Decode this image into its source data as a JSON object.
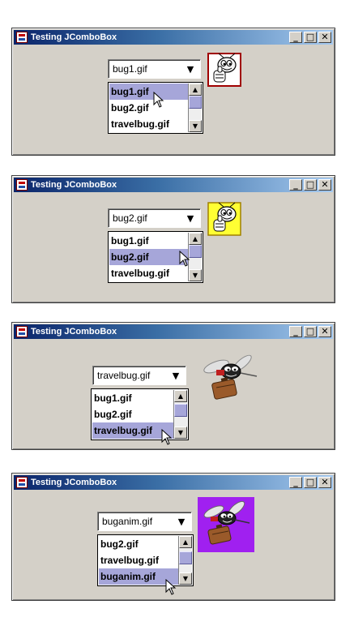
{
  "windows": [
    {
      "title": "Testing JComboBox",
      "combo_value": "bug1.gif",
      "items": [
        "bug1.gif",
        "bug2.gif",
        "travelbug.gif"
      ],
      "selected_index": 0,
      "image": "bug1-icon",
      "buttons": {
        "minimize": "_",
        "maximize": "□",
        "close": "✕"
      }
    },
    {
      "title": "Testing JComboBox",
      "combo_value": "bug2.gif",
      "items": [
        "bug1.gif",
        "bug2.gif",
        "travelbug.gif"
      ],
      "selected_index": 1,
      "image": "bug2-icon",
      "buttons": {
        "minimize": "_",
        "maximize": "□",
        "close": "✕"
      }
    },
    {
      "title": "Testing JComboBox",
      "combo_value": "travelbug.gif",
      "items": [
        "bug1.gif",
        "bug2.gif",
        "travelbug.gif"
      ],
      "selected_index": 2,
      "image": "travelbug-icon",
      "buttons": {
        "minimize": "_",
        "maximize": "□",
        "close": "✕"
      }
    },
    {
      "title": "Testing JComboBox",
      "combo_value": "buganim.gif",
      "items": [
        "bug2.gif",
        "travelbug.gif",
        "buganim.gif"
      ],
      "selected_index": 2,
      "image": "buganim-icon",
      "buttons": {
        "minimize": "_",
        "maximize": "□",
        "close": "✕"
      }
    }
  ],
  "arrow_glyph": "▼",
  "scroll_up_glyph": "▲",
  "scroll_down_glyph": "▼",
  "colors": {
    "selection": "#a6a6d9",
    "window_bg": "#d4d0c8",
    "title_start": "#0a246a",
    "title_end": "#a6caf0"
  }
}
